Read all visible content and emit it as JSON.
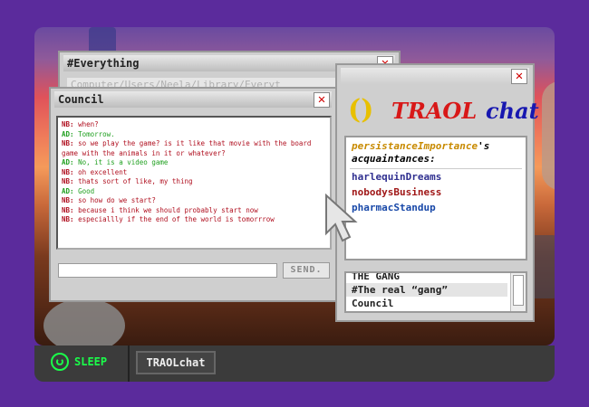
{
  "colors": {
    "frame": "#5b2b9c",
    "accent_green": "#1aff4a",
    "nb_color": "#b01020",
    "ad_color": "#20a020"
  },
  "windows": {
    "everything": {
      "title": "#Everything",
      "path": "Computer/Users/Neela/Library/Everyt",
      "close_icon": "close-icon"
    },
    "council": {
      "title": "Council",
      "messages": [
        {
          "who": "NB:",
          "text": "when?"
        },
        {
          "who": "AD:",
          "text": "Tomorrow."
        },
        {
          "who": "NB:",
          "text": "so we play the game? is it like that movie with the board game with the animals in it or whatever?"
        },
        {
          "who": "AD:",
          "text": "No, it is a video game"
        },
        {
          "who": "NB:",
          "text": "oh excellent"
        },
        {
          "who": "NB:",
          "text": "thats sort of like, my thing"
        },
        {
          "who": "AD:",
          "text": "Good"
        },
        {
          "who": "NB:",
          "text": "so how do we start?"
        },
        {
          "who": "NB:",
          "text": "because i think we should probably start now"
        },
        {
          "who": "NB:",
          "text": "especiallly if the end of the world is tomorrrow"
        }
      ],
      "input_value": "",
      "send_label": "SEND."
    },
    "traol": {
      "logo_mark": "()",
      "logo_t1": "TRAOL",
      "logo_t2": "chat",
      "owner": "persistanceImportance",
      "owner_suffix": "'s",
      "acq_label": "acquaintances:",
      "friends": [
        "harlequinDreams",
        "nobodysBusiness",
        "pharmacStandup"
      ],
      "groups_cut": "THE GANG",
      "groups": [
        "#The real “gang”",
        "Council"
      ]
    }
  },
  "taskbar": {
    "sleep_label": "SLEEP",
    "app_label": "TRAOLchat"
  }
}
